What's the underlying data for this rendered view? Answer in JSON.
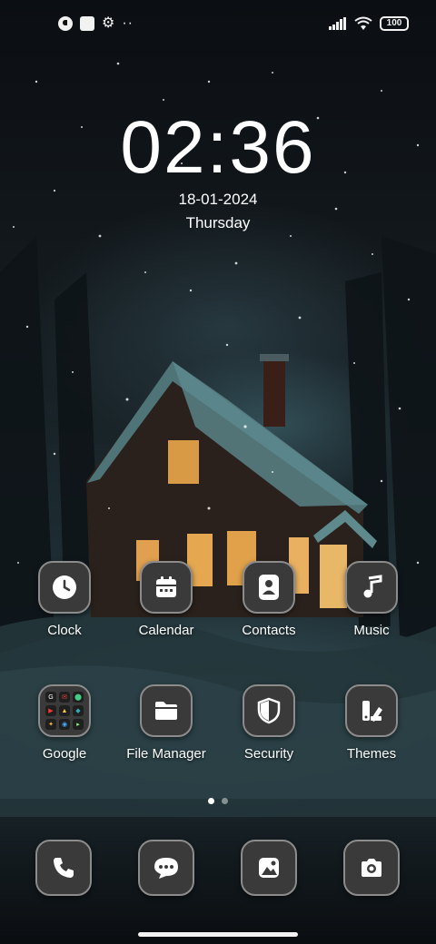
{
  "status": {
    "battery": "100"
  },
  "clock": {
    "time": "02:36",
    "date": "18-01-2024",
    "day": "Thursday"
  },
  "apps_row1": [
    {
      "label": "Clock",
      "icon": "clock-icon"
    },
    {
      "label": "Calendar",
      "icon": "calendar-icon"
    },
    {
      "label": "Contacts",
      "icon": "person-icon"
    },
    {
      "label": "Music",
      "icon": "music-note-icon"
    }
  ],
  "apps_row2": [
    {
      "label": "Google",
      "icon": "folder-grid-icon"
    },
    {
      "label": "File Manager",
      "icon": "folder-icon"
    },
    {
      "label": "Security",
      "icon": "shield-icon"
    },
    {
      "label": "Themes",
      "icon": "themes-icon"
    }
  ],
  "dock": [
    {
      "icon": "phone-icon"
    },
    {
      "icon": "message-icon"
    },
    {
      "icon": "gallery-icon"
    },
    {
      "icon": "camera-icon"
    }
  ],
  "pager": {
    "pages": 2,
    "current": 1
  }
}
